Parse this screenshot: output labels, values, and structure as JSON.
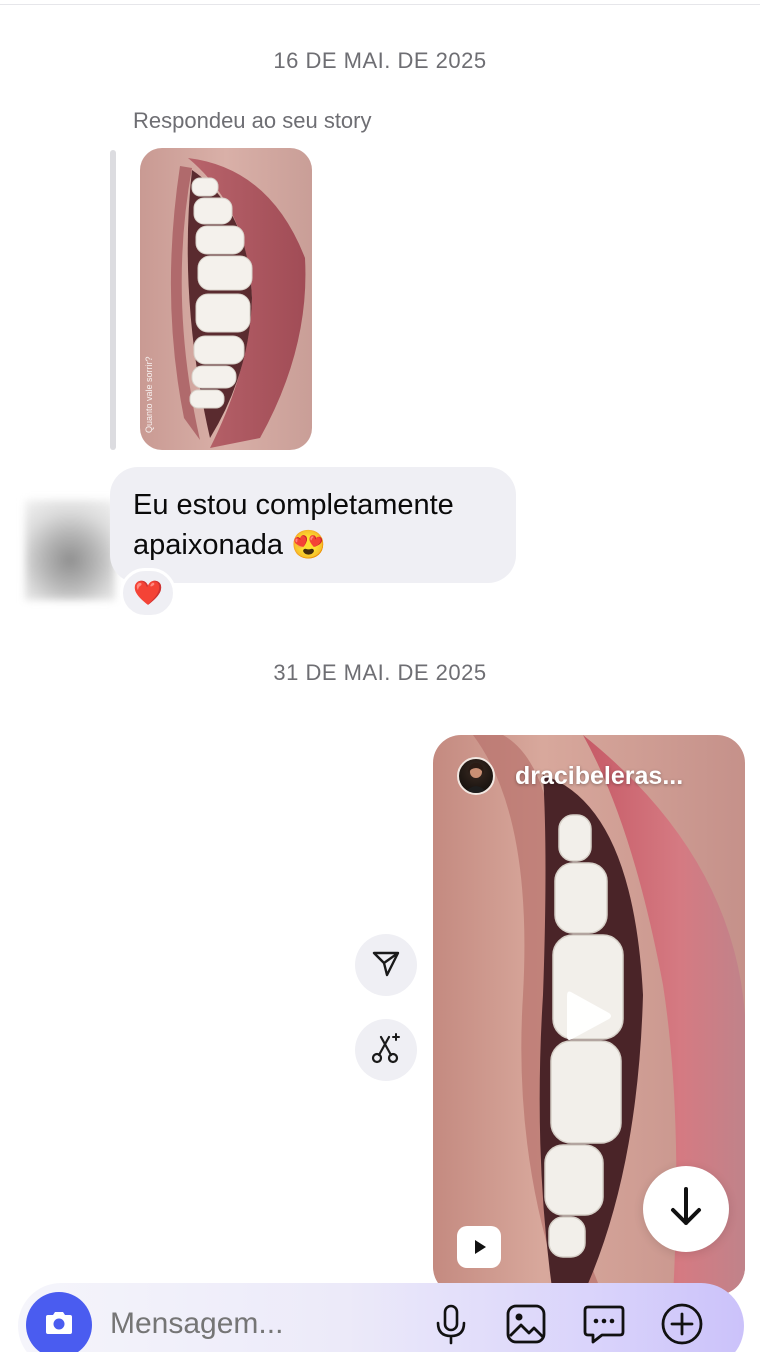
{
  "thread": {
    "date_separators": [
      "16 DE MAI. DE 2025",
      "31 DE MAI. DE 2025"
    ],
    "story_reply": {
      "label": "Respondeu ao seu story",
      "thumbnail_watermark": "Quanto vale sorrir?"
    },
    "incoming_message": {
      "text": "Eu estou completamente apaixonada",
      "emoji": "😍",
      "reaction": "❤️"
    },
    "shared_reel": {
      "author": "dracibeleras...",
      "icons": [
        "play-icon",
        "reel-icon"
      ]
    },
    "side_actions": [
      "share-icon",
      "remix-icon"
    ],
    "scroll_down_icon": "arrow-down-icon"
  },
  "composer": {
    "placeholder": "Mensagem...",
    "icons": [
      "camera-icon",
      "microphone-icon",
      "gallery-icon",
      "sticker-icon",
      "plus-icon"
    ]
  },
  "colors": {
    "accent": "#4a5cf0",
    "bubble_incoming": "#efeff4",
    "meta_text": "#6e6e73",
    "reaction_heart": "#e0243a"
  }
}
